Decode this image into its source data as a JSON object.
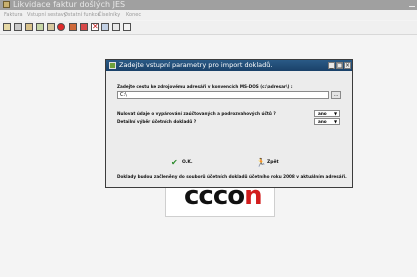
{
  "app": {
    "title": "Likvidace faktur došlých  JES",
    "menu": [
      "Faktura",
      "Vstupní sestavy",
      "Ostatní funkce",
      "Číselníky",
      "Konec"
    ]
  },
  "toolbar": {
    "icons": [
      "new-doc-icon",
      "print-icon",
      "edit-icon",
      "copy-icon",
      "export-icon",
      "stop-icon",
      "exit-door-icon",
      "arrow-icon",
      "delete-icon",
      "tools-icon",
      "table-icon",
      "doc-icon"
    ]
  },
  "logo": {
    "prefix": "ccco",
    "accent": "n"
  },
  "dialog": {
    "title": "Zadejte vstupní parametry pro import dokladů.",
    "path_label": "Zadejte cestu ke zdrojovému adresáři v konvencích MS-DOS (c:\\adresar\\) :",
    "path_value": "C:\\",
    "browse_label": "...",
    "question1": "Nulovat údaje o vypárování zaúčtovaných a podrozvahových účtů ?",
    "question1_value": "ano",
    "question2": "Detailní výběr účetních dokladů ?",
    "question2_value": "ano",
    "ok_label": "O.K.",
    "back_label": "Zpět",
    "footer": "Doklady budou začleněny do souborů účetních dokladů účetního roku 2008 v aktuálním adresáři."
  }
}
